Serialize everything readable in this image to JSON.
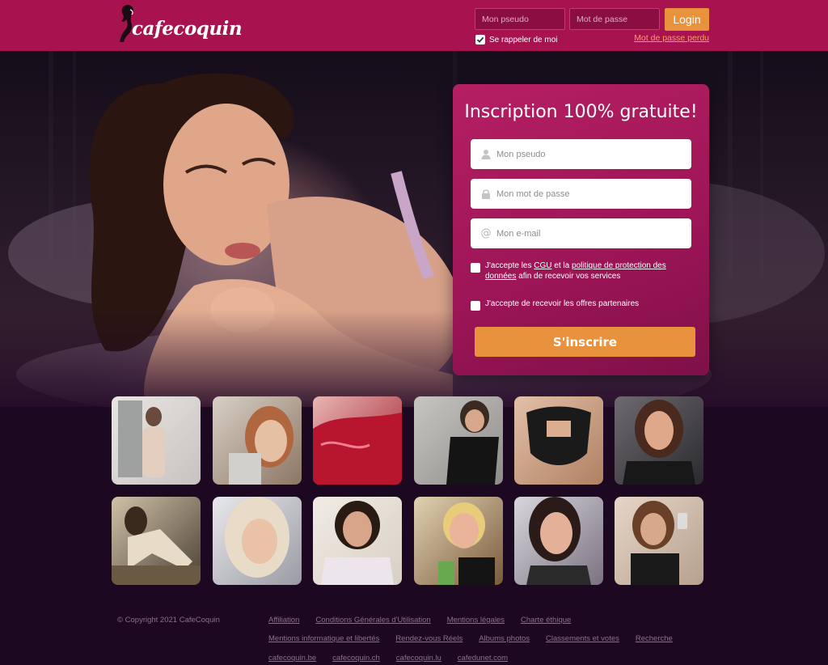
{
  "header": {
    "logo_text": "cafecoquin",
    "username_placeholder": "Mon pseudo",
    "password_placeholder": "Mot de passe",
    "login_label": "Login",
    "remember_label": "Se rappeler de moi",
    "remember_checked": true,
    "forgot_password": "Mot de passe perdu"
  },
  "signup": {
    "title": "Inscription 100% gratuite!",
    "pseudo_placeholder": "Mon pseudo",
    "password_placeholder": "Mon mot de passe",
    "email_placeholder": "Mon e-mail",
    "consent1_prefix": "J'accepte les ",
    "consent1_cgu": "CGU",
    "consent1_mid": " et la ",
    "consent1_policy_line1": "politique de protection des",
    "consent1_policy_line2": "données",
    "consent1_suffix": " afin de recevoir vos services",
    "consent2": "J'accepte de recevoir les offres partenaires",
    "submit_label": "S'inscrire"
  },
  "profiles": {
    "row1": [
      "profile-1",
      "profile-2",
      "profile-3",
      "profile-4",
      "profile-5",
      "profile-6"
    ],
    "row2": [
      "profile-7",
      "profile-8",
      "profile-9",
      "profile-10",
      "profile-11",
      "profile-12"
    ]
  },
  "footer": {
    "copyright": "© Copyright 2021 CafeCoquin",
    "row1": [
      "Affiliation",
      "Conditions Générales d'Utilisation",
      "Mentions légales",
      "Charte éthique"
    ],
    "row2": [
      "Mentions informatique et libertés",
      "Rendez-vous Réels",
      "Albums photos",
      "Classements et votes",
      "Recherche"
    ],
    "row3": [
      "cafecoquin.be",
      "cafecoquin.ch",
      "cafecoquin.lu",
      "cafedunet.com"
    ]
  },
  "colors": {
    "header_bg": "#a8124e",
    "accent_orange": "#e8923e",
    "card_pink": "#b51f63",
    "page_bg": "#1c0820"
  }
}
